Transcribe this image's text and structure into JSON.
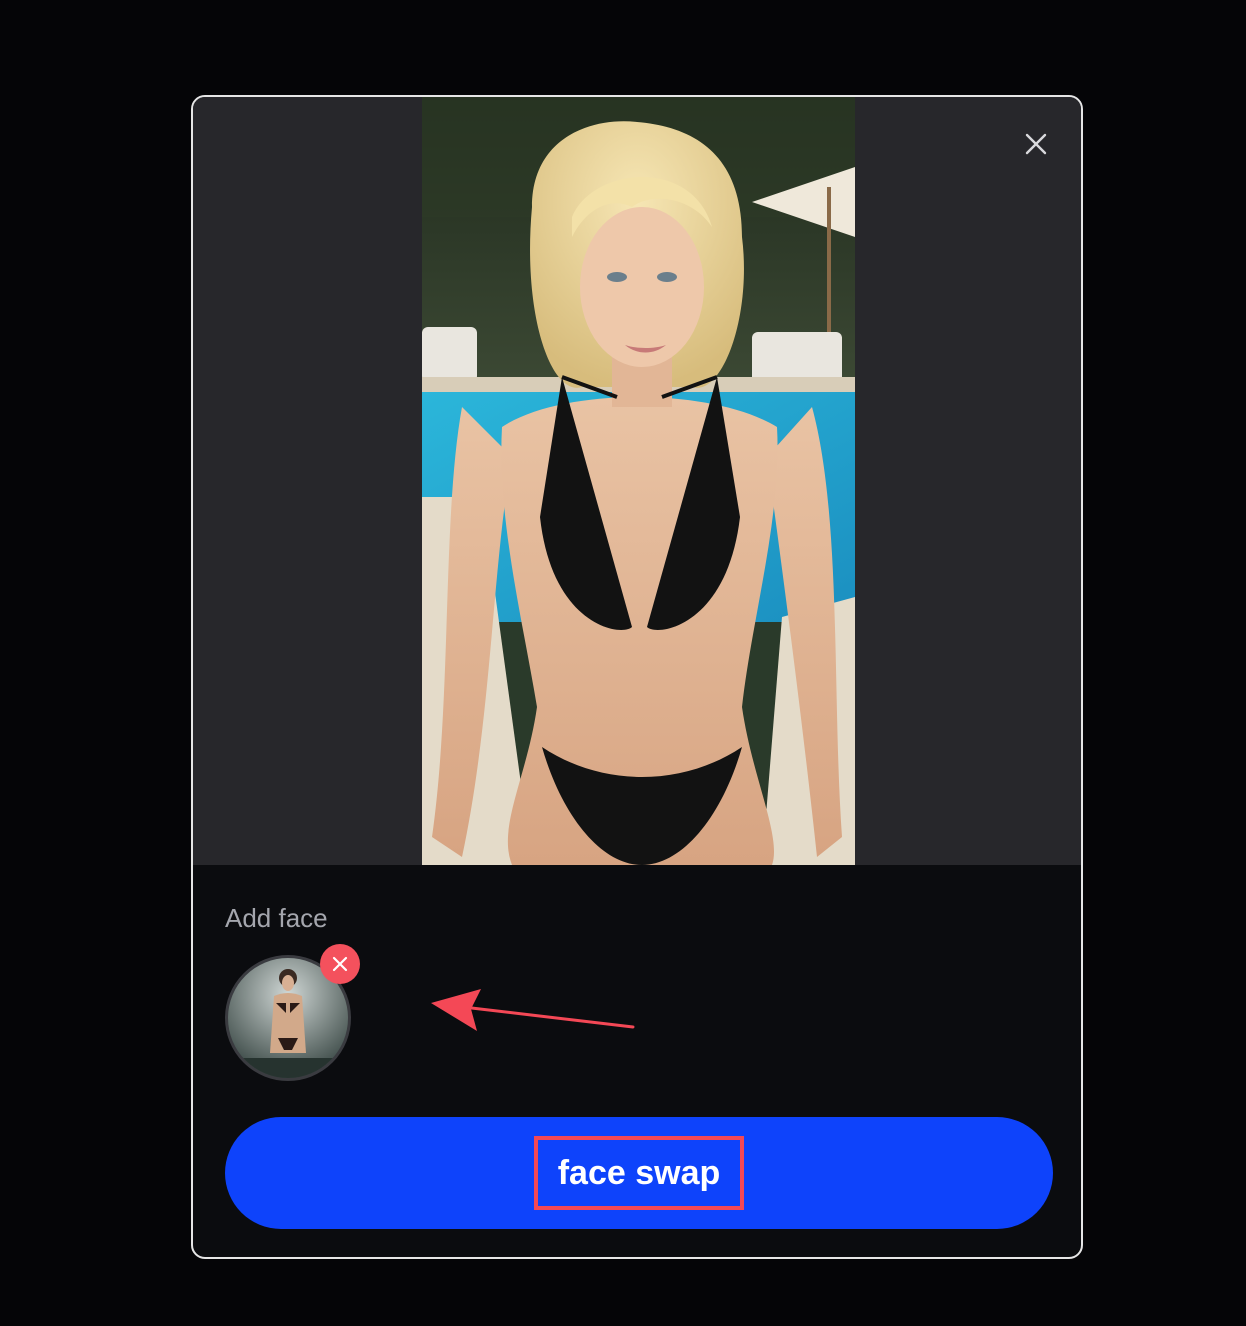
{
  "modal": {
    "close_icon": "close-icon",
    "preview": {
      "icon": "generated-image",
      "description_visible": false
    },
    "add_face": {
      "title": "Add face",
      "thumbnail_icon": "face-photo-thumbnail",
      "remove_icon": "remove-x-icon"
    },
    "swap_button": {
      "label": "face swap"
    }
  },
  "colors": {
    "accent": "#0e43fb",
    "annotation": "#f44856",
    "remove_badge": "#f4515d",
    "modal_border": "#e6e6e6"
  }
}
